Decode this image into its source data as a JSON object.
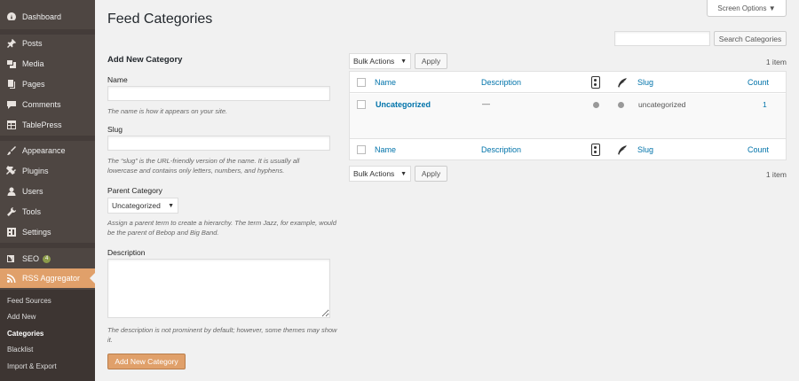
{
  "sidebar": {
    "menu": [
      {
        "label": "Dashboard",
        "icon": "dashboard-icon"
      },
      {
        "label": "Posts",
        "icon": "pin-icon"
      },
      {
        "label": "Media",
        "icon": "media-icon"
      },
      {
        "label": "Pages",
        "icon": "pages-icon"
      },
      {
        "label": "Comments",
        "icon": "comments-icon"
      },
      {
        "label": "TablePress",
        "icon": "table-icon"
      },
      {
        "label": "Appearance",
        "icon": "brush-icon"
      },
      {
        "label": "Plugins",
        "icon": "plugin-icon"
      },
      {
        "label": "Users",
        "icon": "user-icon"
      },
      {
        "label": "Tools",
        "icon": "wrench-icon"
      },
      {
        "label": "Settings",
        "icon": "settings-icon"
      },
      {
        "label": "SEO",
        "icon": "yoast-icon",
        "badge": "4"
      },
      {
        "label": "RSS Aggregator",
        "icon": "rss-icon"
      }
    ],
    "submenu": [
      "Feed Sources",
      "Add New",
      "Categories",
      "Blacklist",
      "Import & Export"
    ]
  },
  "header": {
    "title": "Feed Categories",
    "screen_options": "Screen Options ▼"
  },
  "search": {
    "button": "Search Categories",
    "value": ""
  },
  "form": {
    "heading": "Add New Category",
    "name_label": "Name",
    "name_help": "The name is how it appears on your site.",
    "slug_label": "Slug",
    "slug_help": "The “slug” is the URL-friendly version of the name. It is usually all lowercase and contains only letters, numbers, and hyphens.",
    "parent_label": "Parent Category",
    "parent_value": "Uncategorized",
    "parent_help": "Assign a parent term to create a hierarchy. The term Jazz, for example, would be the parent of Bebop and Big Band.",
    "description_label": "Description",
    "description_help": "The description is not prominent by default; however, some themes may show it.",
    "submit": "Add New Category"
  },
  "list": {
    "bulk_actions": "Bulk Actions",
    "apply": "Apply",
    "item_count": "1 item",
    "columns": {
      "name": "Name",
      "description": "Description",
      "slug": "Slug",
      "count": "Count"
    },
    "rows": [
      {
        "name": "Uncategorized",
        "description": "—",
        "slug": "uncategorized",
        "count": "1"
      }
    ]
  }
}
